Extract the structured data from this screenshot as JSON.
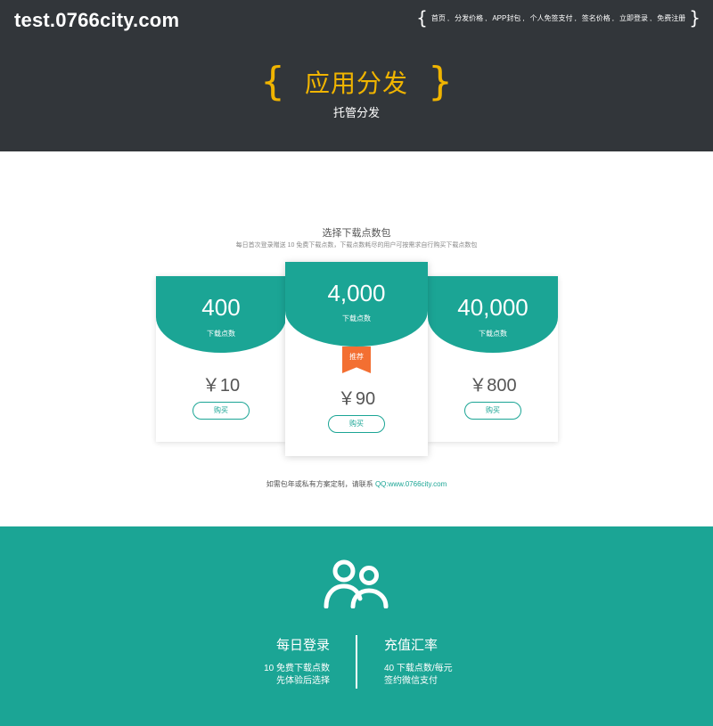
{
  "header": {
    "logo": "test.0766city.com",
    "brace_open": "{",
    "brace_close": "}",
    "nav": [
      {
        "label": "首页"
      },
      {
        "label": "分发价格"
      },
      {
        "label": "APP封包"
      },
      {
        "label": "个人免签支付"
      },
      {
        "label": "签名价格"
      },
      {
        "label": "立即登录"
      },
      {
        "label": "免费注册"
      }
    ],
    "nav_separator": ",",
    "hero_title": "应用分发",
    "hero_subtitle": "托管分发"
  },
  "pricing": {
    "title": "选择下载点数包",
    "description": "每日首次登录赠送 10 免费下载点数，下载点数耗尽的用户可按需求自行购买下载点数包",
    "cards": [
      {
        "amount": "400",
        "unit": "下载点数",
        "price": "￥10",
        "buy": "购买"
      },
      {
        "amount": "4,000",
        "unit": "下载点数",
        "badge": "推荐",
        "price": "￥90",
        "buy": "购买"
      },
      {
        "amount": "40,000",
        "unit": "下载点数",
        "price": "￥800",
        "buy": "购买"
      }
    ],
    "contact_text": "如需包年或私有方案定制，请联系 ",
    "contact_link": "QQ:www.0766city.com"
  },
  "band": {
    "icon": "users-icon",
    "left": {
      "heading": "每日登录",
      "line1": "10 免费下载点数",
      "line2": "先体验后选择"
    },
    "right": {
      "heading": "充值汇率",
      "line1": "40 下载点数/每元",
      "line2": "签约微信支付"
    }
  },
  "colors": {
    "header_bg": "#32363a",
    "accent_gold": "#f0b400",
    "teal": "#1ba595",
    "badge_orange": "#f36f32"
  }
}
